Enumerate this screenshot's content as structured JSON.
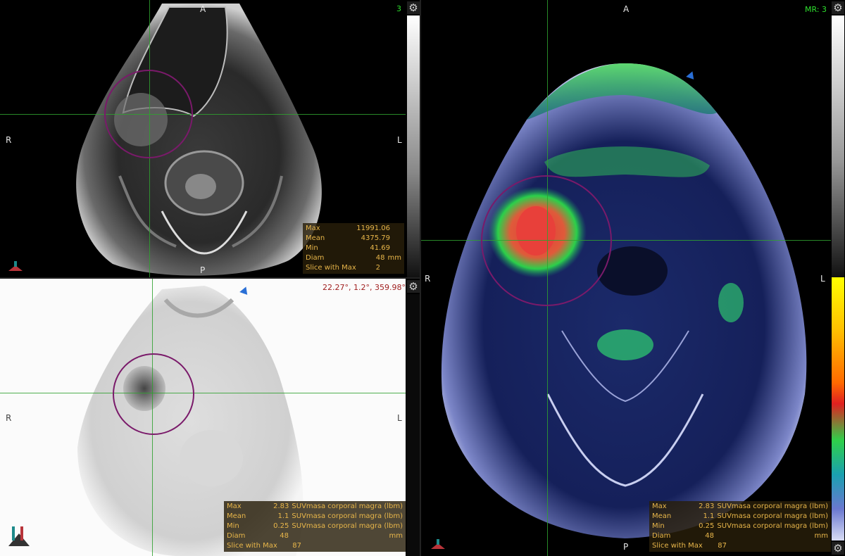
{
  "views": {
    "mr_axial": {
      "orientation": {
        "top": "A",
        "bottom": "P",
        "left": "R",
        "right": "L"
      },
      "series_label": "3",
      "stats": [
        {
          "label": "Max",
          "value": "11991.06",
          "unit": ""
        },
        {
          "label": "Mean",
          "value": "4375.79",
          "unit": ""
        },
        {
          "label": "Min",
          "value": "41.69",
          "unit": ""
        },
        {
          "label": "Diam",
          "value": "48",
          "unit": "mm"
        },
        {
          "label": "Slice with Max",
          "value": "2",
          "unit": ""
        }
      ]
    },
    "pet_axial": {
      "orientation": {
        "left": "R",
        "right": "L"
      },
      "angles": "22.27°, 1.2°, 359.98°",
      "stats": [
        {
          "label": "Max",
          "value": "2.83",
          "unit": "SUVmasa corporal magra (lbm)"
        },
        {
          "label": "Mean",
          "value": "1.1",
          "unit": "SUVmasa corporal magra (lbm)"
        },
        {
          "label": "Min",
          "value": "0.25",
          "unit": "SUVmasa corporal magra (lbm)"
        },
        {
          "label": "Diam",
          "value": "48",
          "unit": "mm"
        },
        {
          "label": "Slice with Max",
          "value": "87",
          "unit": ""
        }
      ]
    },
    "fusion_axial": {
      "orientation": {
        "top": "A",
        "bottom": "P",
        "left": "R",
        "right": "L"
      },
      "series_label": "MR: 3",
      "stats": [
        {
          "label": "Max",
          "value": "2.83",
          "unit": "SUVmasa corporal magra (lbm)"
        },
        {
          "label": "Mean",
          "value": "1.1",
          "unit": "SUVmasa corporal magra (lbm)"
        },
        {
          "label": "Min",
          "value": "0.25",
          "unit": "SUVmasa corporal magra (lbm)"
        },
        {
          "label": "Diam",
          "value": "48",
          "unit": "mm"
        },
        {
          "label": "Slice with Max",
          "value": "87",
          "unit": ""
        }
      ]
    }
  },
  "icons": {
    "settings": "gear-icon",
    "orientation_cube": "orientation-cube-icon",
    "direction_arrow": "arrow-icon"
  },
  "colors": {
    "crosshair": "#2fa12f",
    "roi": "#7a1a6a",
    "stats_text": "#e8b64a",
    "series_label": "#2ee02e",
    "angles": "#a02020"
  }
}
